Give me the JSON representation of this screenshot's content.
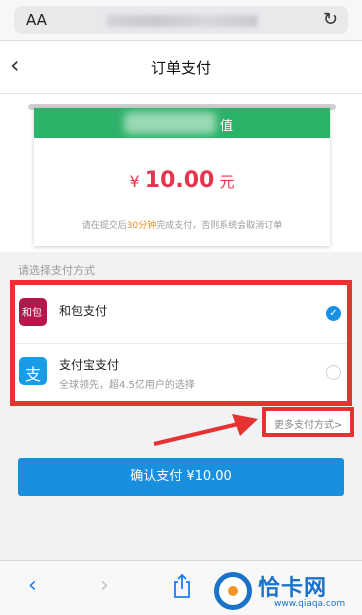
{
  "browser": {
    "text_size_label": "AA",
    "reload_icon": "reload-icon"
  },
  "nav": {
    "back_icon": "chevron-left-icon",
    "title": "订单支付"
  },
  "order": {
    "header_suffix": "值",
    "currency_symbol": "¥",
    "amount": "10.00",
    "amount_unit": "元",
    "notice_prefix": "请在提交后",
    "notice_highlight": "30分钟",
    "notice_suffix": "完成支付，否则系统会取消订单"
  },
  "payment": {
    "section_label": "请选择支付方式",
    "methods": [
      {
        "name": "和包支付",
        "description": "",
        "selected": true,
        "icon": "hebao-icon"
      },
      {
        "name": "支付宝支付",
        "description": "全球领先，超4.5亿用户的选择",
        "selected": false,
        "icon": "alipay-icon"
      }
    ],
    "more_label": "更多支付方式>"
  },
  "confirm": {
    "label": "确认支付 ¥10.00"
  },
  "toolbar": {
    "items": [
      "back-icon",
      "forward-icon",
      "share-icon"
    ]
  },
  "watermark": {
    "brand": "恰卡网",
    "url": "www.qiaqa.com"
  },
  "colors": {
    "accent_blue": "#1a8fde",
    "header_green": "#2db26a",
    "amount_red": "#e8334f",
    "highlight_border": "#e63232"
  }
}
